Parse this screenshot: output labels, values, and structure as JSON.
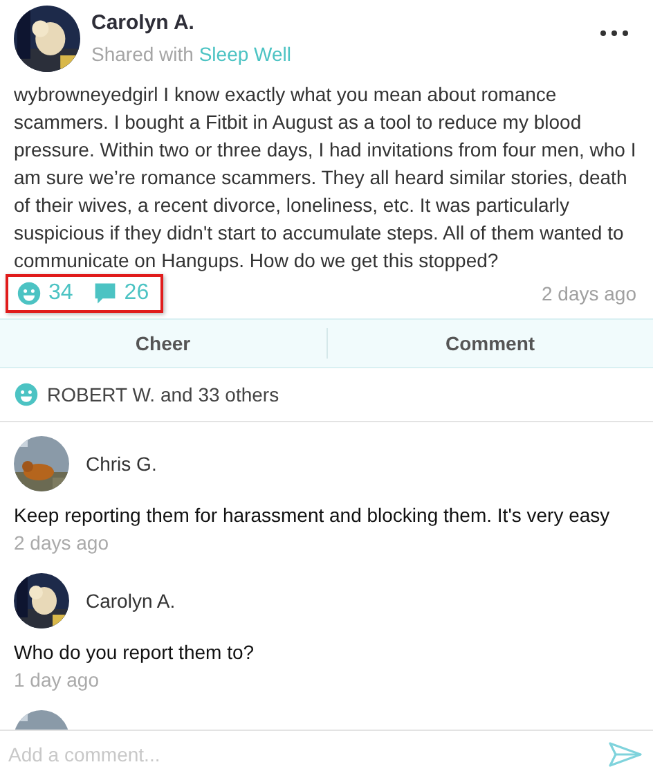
{
  "post": {
    "author": "Carolyn A.",
    "shared_prefix": "Shared with",
    "group": "Sleep Well",
    "text": "wybrowneyedgirl I know exactly what you mean about romance scammers. I bought a Fitbit in August as a tool to reduce my blood pressure. Within two or three days, I had invitations from four men, who I am sure we’re romance scammers. They all heard similar stories, death of their wives, a recent divorce, loneliness, etc. It was particularly suspicious if they didn't start to accumulate steps. All of them wanted to communicate on Hangups. How do we get this stopped?",
    "cheers": "34",
    "comments_count": "26",
    "time": "2 days ago",
    "stats_highlighted": true
  },
  "actions": [
    "Cheer",
    "Comment"
  ],
  "cheered_by": "ROBERT W. and 33 others",
  "comments": [
    {
      "kind": "comment",
      "author": "Chris G.",
      "text": "Keep reporting them for harassment and blocking them. It's very easy",
      "time": "2 days ago"
    },
    {
      "kind": "comment",
      "author": "Carolyn A.",
      "text": "Who do you report them to?",
      "time": "1 day ago"
    },
    {
      "kind": "cut_off"
    }
  ],
  "composer": {
    "placeholder": "Add a comment..."
  }
}
